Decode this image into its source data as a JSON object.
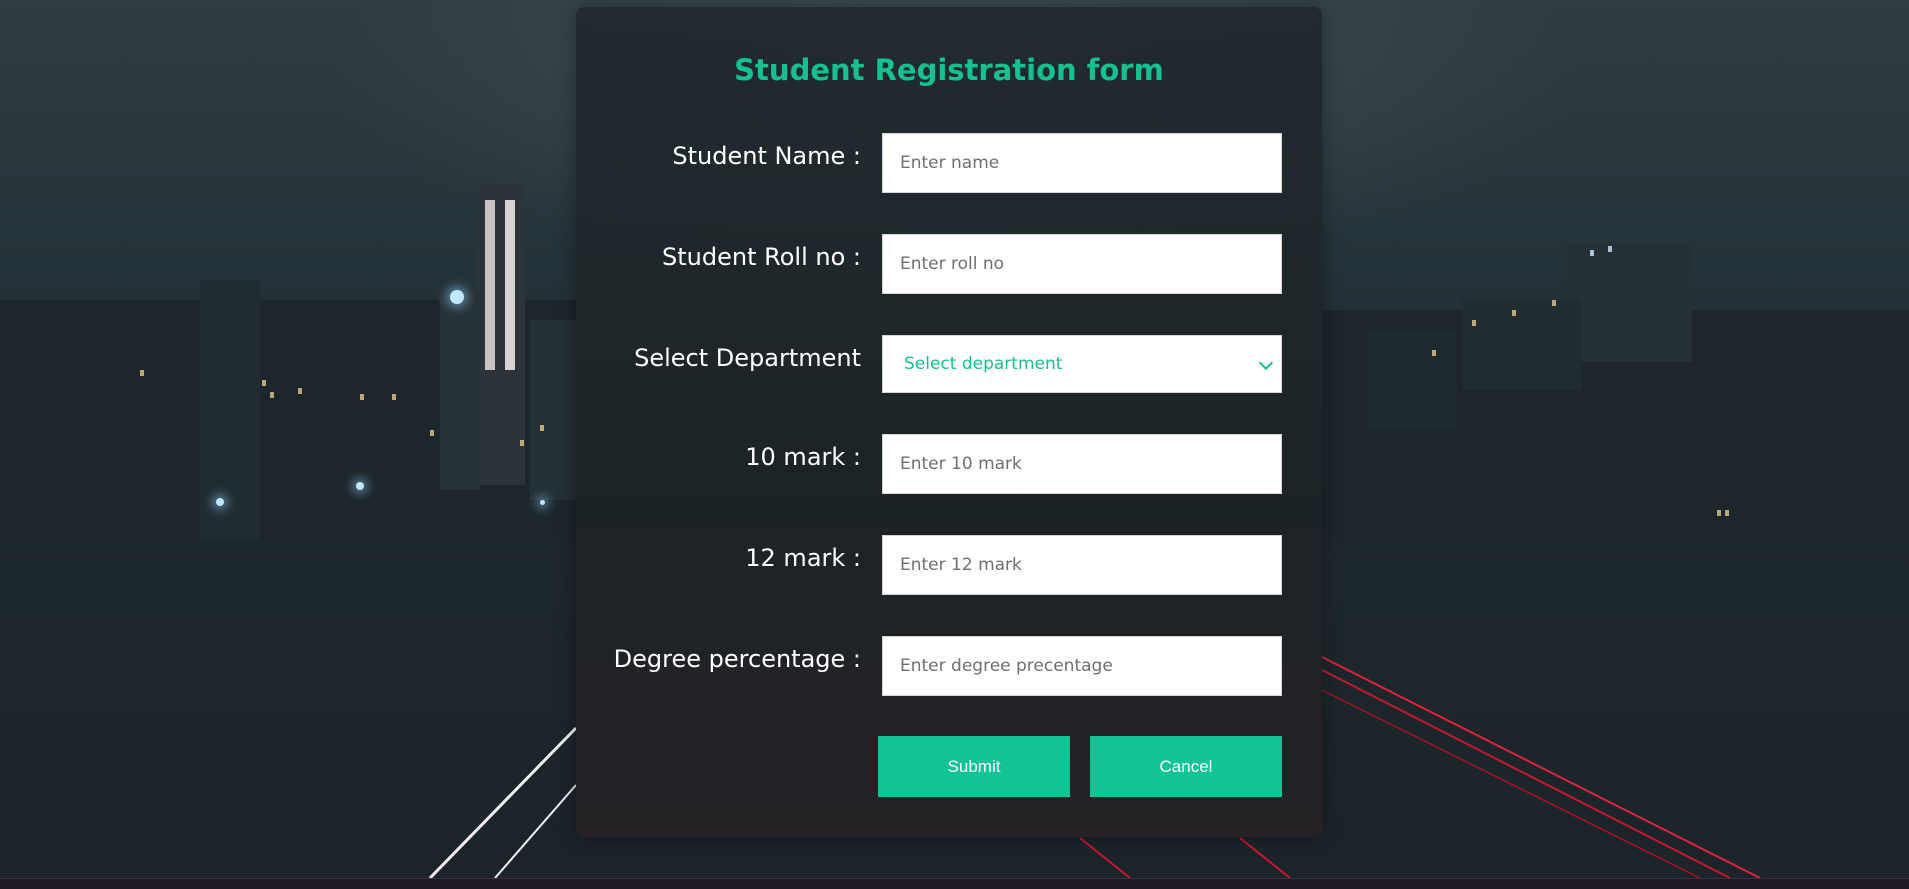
{
  "form": {
    "title": "Student Registration form",
    "fields": [
      {
        "label": "Student Name :",
        "placeholder": "Enter name"
      },
      {
        "label": "Student Roll no :",
        "placeholder": "Enter roll no"
      },
      {
        "label": "Select Department",
        "selected": "Select department",
        "icon": "chevron-down-icon"
      },
      {
        "label": "10 mark :",
        "placeholder": "Enter 10 mark"
      },
      {
        "label": "12 mark :",
        "placeholder": "Enter 12 mark"
      },
      {
        "label": "Degree percentage :",
        "placeholder": "Enter degree precentage"
      }
    ],
    "buttons": {
      "submit": "Submit",
      "cancel": "Cancel"
    }
  },
  "colors": {
    "accent": "#12c394",
    "title": "#16c092",
    "label": "#ffffff",
    "panel": "#1f292d"
  }
}
